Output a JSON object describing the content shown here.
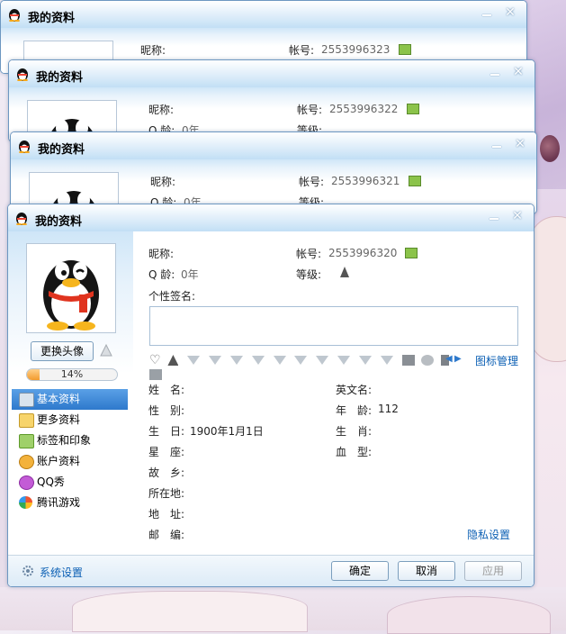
{
  "windows": [
    {
      "title": "我的资料",
      "nickname_label": "昵称:",
      "account_label": "帐号:",
      "account": "2553996323"
    },
    {
      "title": "我的资料",
      "nickname_label": "昵称:",
      "account_label": "帐号:",
      "account": "2553996322",
      "qage_label": "Q 龄:",
      "qage": "0年",
      "level_label": "等级:"
    },
    {
      "title": "我的资料",
      "nickname_label": "昵称:",
      "account_label": "帐号:",
      "account": "2553996321",
      "qage_label": "Q 龄:",
      "qage": "0年",
      "level_label": "等级:"
    }
  ],
  "main": {
    "title": "我的资料",
    "nickname_label": "昵称:",
    "account_label": "帐号:",
    "account": "2553996320",
    "qage_label": "Q 龄:",
    "qage": "0年",
    "level_label": "等级:",
    "signature_label": "个性签名:",
    "change_avatar": "更换头像",
    "progress_text": "14%",
    "progress_value": 0.14,
    "icon_manage": "图标管理",
    "nav": [
      {
        "label": "基本资料",
        "icon": "profile-card-icon",
        "active": true
      },
      {
        "label": "更多资料",
        "icon": "more-info-icon",
        "active": false
      },
      {
        "label": "标签和印象",
        "icon": "tag-icon",
        "active": false
      },
      {
        "label": "账户资料",
        "icon": "account-icon",
        "active": false
      },
      {
        "label": "QQ秀",
        "icon": "qqshow-icon",
        "active": false
      },
      {
        "label": "腾讯游戏",
        "icon": "game-icon",
        "active": false
      }
    ],
    "fields": {
      "name_label": "姓　名:",
      "english_name_label": "英文名:",
      "gender_label": "性　别:",
      "age_label": "年　龄:",
      "age": "112",
      "birthday_label": "生　日:",
      "birthday": "1900年1月1日",
      "zodiac_label": "生　肖:",
      "constellation_label": "星　座:",
      "blood_label": "血　型:",
      "hometown_label": "故　乡:",
      "location_label": "所在地:",
      "address_label": "地　址:",
      "zipcode_label": "邮　编:"
    },
    "privacy_settings": "隐私设置",
    "system_settings": "系统设置",
    "ok": "确定",
    "cancel": "取消",
    "apply": "应用",
    "colors": {
      "accent": "#2e79cc",
      "link": "#0b5fb4",
      "progress": "#f39b2c"
    }
  }
}
